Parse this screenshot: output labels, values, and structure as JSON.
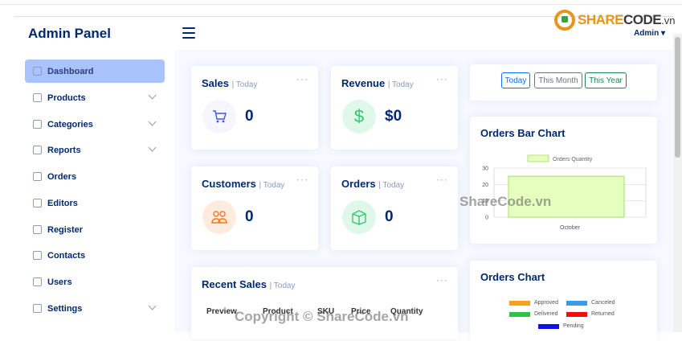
{
  "app": {
    "title": "Admin Panel",
    "user": "Admin"
  },
  "logo": {
    "part1": "SHARE",
    "part2": "CODE",
    "part3": ".vn"
  },
  "sidebar": {
    "items": [
      {
        "label": "Dashboard",
        "icon": "grid-icon",
        "chevron": false,
        "active": true
      },
      {
        "label": "Products",
        "icon": "box-icon",
        "chevron": true
      },
      {
        "label": "Categories",
        "icon": "list-icon",
        "chevron": true
      },
      {
        "label": "Reports",
        "icon": "bar-chart-icon",
        "chevron": true
      },
      {
        "label": "Orders",
        "icon": "list-ul-icon",
        "chevron": false
      },
      {
        "label": "Editors",
        "icon": "pencil-icon",
        "chevron": false
      },
      {
        "label": "Register",
        "icon": "person-icon",
        "chevron": false
      },
      {
        "label": "Contacts",
        "icon": "envelope-icon",
        "chevron": false
      },
      {
        "label": "Users",
        "icon": "people-icon",
        "chevron": false
      },
      {
        "label": "Settings",
        "icon": "gear-icon",
        "chevron": true
      }
    ]
  },
  "cards": {
    "sales": {
      "title": "Sales",
      "period": "| Today",
      "value": "0"
    },
    "revenue": {
      "title": "Revenue",
      "period": "| Today",
      "value": "$0"
    },
    "customers": {
      "title": "Customers",
      "period": "| Today",
      "value": "0"
    },
    "orders": {
      "title": "Orders",
      "period": "| Today",
      "value": "0"
    },
    "recent": {
      "title": "Recent Sales",
      "period": "| Today",
      "columns": [
        "Preview",
        "Product",
        "SKU",
        "Price",
        "Quantity"
      ]
    }
  },
  "filters": [
    "Today",
    "This Month",
    "This Year"
  ],
  "ordersBarChart": {
    "title": "Orders Bar Chart"
  },
  "ordersChart": {
    "title": "Orders Chart",
    "legend": [
      "Approved",
      "Canceled",
      "Delivered",
      "Returned",
      "Pending"
    ]
  },
  "chart_data": [
    {
      "type": "bar",
      "categories": [
        "October"
      ],
      "series": [
        {
          "name": "Orders Quantity",
          "values": [
            25
          ]
        }
      ],
      "ylim": [
        0,
        30
      ],
      "yticks": [
        0,
        10,
        20,
        30
      ],
      "legend_position": "top",
      "colors": [
        "#e7ffbe"
      ]
    },
    {
      "type": "pie",
      "series": [
        {
          "name": "Approved",
          "color": "#f5a21a"
        },
        {
          "name": "Canceled",
          "color": "#3c9be4"
        },
        {
          "name": "Delivered",
          "color": "#2ec24a"
        },
        {
          "name": "Returned",
          "color": "#ee1010"
        },
        {
          "name": "Pending",
          "color": "#1010ee"
        }
      ]
    }
  ],
  "watermarks": {
    "center": "ShareCode.vn",
    "bottom": "Copyright © ShareCode.vn"
  }
}
